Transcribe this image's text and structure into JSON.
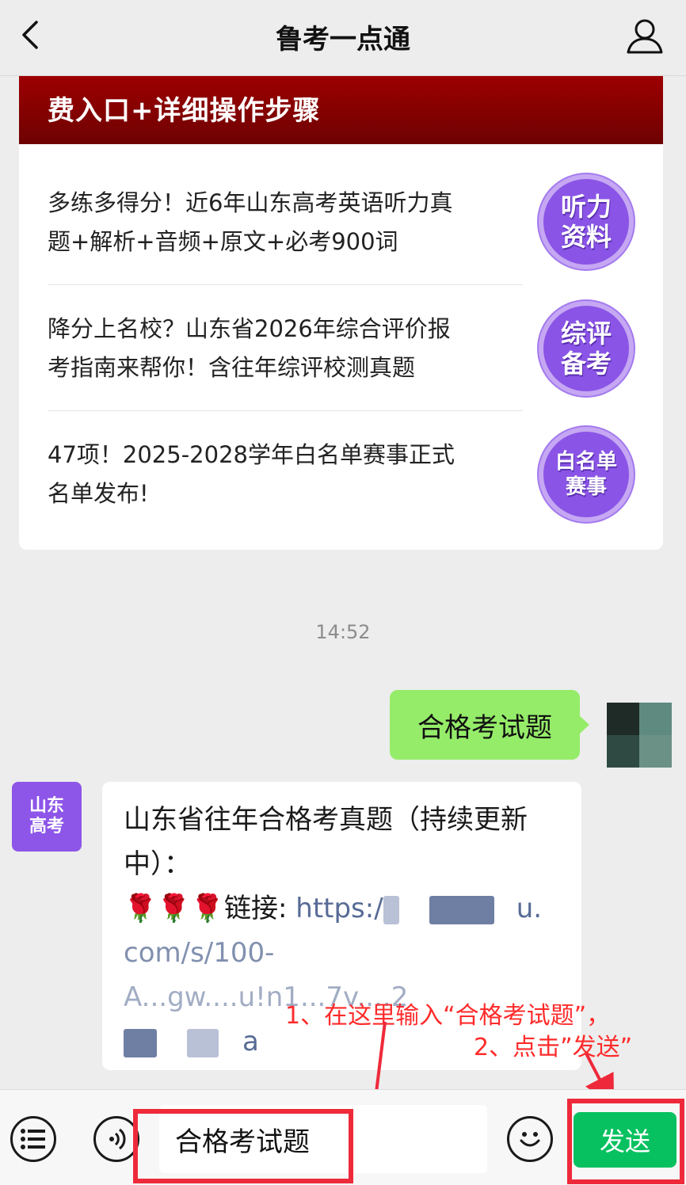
{
  "header": {
    "title": "鲁考一点通"
  },
  "card": {
    "header_text": "费入口+详细操作步骤",
    "items": [
      {
        "line1": "多练多得分！近6年山东高考英语听力真",
        "line2": "题+解析+音频+原文+必考900词",
        "badge": [
          "听力",
          "资料"
        ]
      },
      {
        "line1": "降分上名校？山东省2026年综合评价报",
        "line2": "考指南来帮你！含往年综评校测真题",
        "badge": [
          "综评",
          "备考"
        ]
      },
      {
        "line1": "47项！2025-2028学年白名单赛事正式",
        "line2": "名单发布!",
        "badge": [
          "白名单",
          "赛事"
        ]
      }
    ]
  },
  "chat": {
    "timestamp": "14:52",
    "outgoing": {
      "text": "合格考试题"
    },
    "incoming": {
      "avatar_lines": [
        "山东",
        "高考"
      ],
      "line1": "山东省往年合格考真题（持续更新",
      "line2": "中）：",
      "link_prefix": "🌹🌹🌹链接: ",
      "link_visible_start": "https:/",
      "link_visible_end": "u.",
      "link_line2": "com/s/100-",
      "link_line3": "A...gw....u!n1...7v....2",
      "link_line4": "a"
    }
  },
  "annotations": {
    "step1": "1、在这里输入“合格考试题”，",
    "step2": "2、点击”发送”"
  },
  "inputbar": {
    "value": "合格考试题",
    "send_label": "发送"
  },
  "colors": {
    "accent": "#07c160",
    "bubble_out": "#95ec69",
    "annotation": "#ee2a3a",
    "brand_purple": "#8d55e8"
  }
}
